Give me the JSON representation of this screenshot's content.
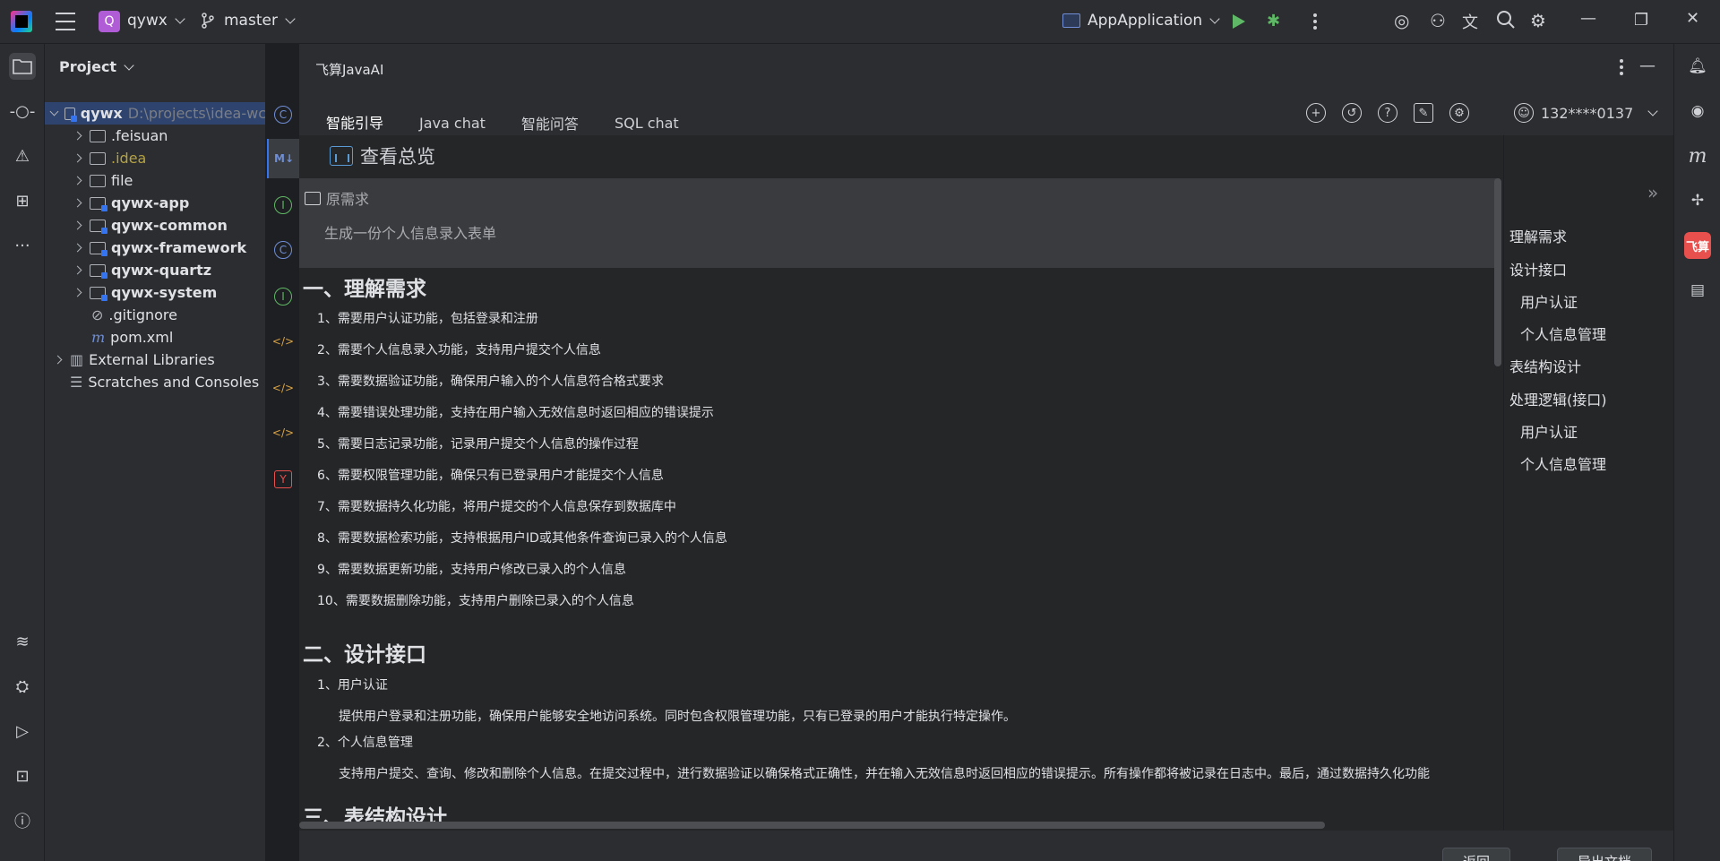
{
  "titlebar": {
    "project_badge": "Q",
    "project_name": "qywx",
    "branch": "master",
    "run_config": "AppApplication"
  },
  "project_panel": {
    "title": "Project",
    "tree": [
      {
        "label": "qywx",
        "path": "D:\\projects\\idea-wc",
        "bold": true,
        "expanded": true,
        "level": 0
      },
      {
        "label": ".feisuan",
        "level": 1
      },
      {
        "label": ".idea",
        "level": 1,
        "color": "yellow"
      },
      {
        "label": "file",
        "level": 1
      },
      {
        "label": "qywx-app",
        "level": 1,
        "bold": true
      },
      {
        "label": "qywx-common",
        "level": 1,
        "bold": true
      },
      {
        "label": "qywx-framework",
        "level": 1,
        "bold": true
      },
      {
        "label": "qywx-quartz",
        "level": 1,
        "bold": true
      },
      {
        "label": "qywx-system",
        "level": 1,
        "bold": true
      },
      {
        "label": ".gitignore",
        "level": 1
      },
      {
        "label": "pom.xml",
        "level": 1
      },
      {
        "label": "External Libraries",
        "level": 0
      },
      {
        "label": "Scratches and Consoles",
        "level": 0
      }
    ]
  },
  "editor_strip": {
    "md_tab": "M↓"
  },
  "ai_panel": {
    "title": "飞算JavaAI",
    "tabs": [
      "智能引导",
      "Java chat",
      "智能问答",
      "SQL chat"
    ],
    "user": "132****0137",
    "overview": "查看总览",
    "requirement_label": "原需求",
    "requirement_text": "生成一份个人信息录入表单",
    "section1_title": "一、理解需求",
    "section1_items": [
      "1、需要用户认证功能，包括登录和注册",
      "2、需要个人信息录入功能，支持用户提交个人信息",
      "3、需要数据验证功能，确保用户输入的个人信息符合格式要求",
      "4、需要错误处理功能，支持在用户输入无效信息时返回相应的错误提示",
      "5、需要日志记录功能，记录用户提交个人信息的操作过程",
      "6、需要权限管理功能，确保只有已登录用户才能提交个人信息",
      "7、需要数据持久化功能，将用户提交的个人信息保存到数据库中",
      "8、需要数据检索功能，支持根据用户ID或其他条件查询已录入的个人信息",
      "9、需要数据更新功能，支持用户修改已录入的个人信息",
      "10、需要数据删除功能，支持用户删除已录入的个人信息"
    ],
    "section2_title": "二、设计接口",
    "section2_subs": [
      {
        "title": "1、用户认证",
        "desc": "提供用户登录和注册功能，确保用户能够安全地访问系统。同时包含权限管理功能，只有已登录的用户才能执行特定操作。"
      },
      {
        "title": "2、个人信息管理",
        "desc": "支持用户提交、查询、修改和删除个人信息。在提交过程中，进行数据验证以确保格式正确性，并在输入无效信息时返回相应的错误提示。所有操作都将被记录在日志中。最后，通过数据持久化功能"
      }
    ],
    "section3_title": "三、表结构设计",
    "toc": [
      "理解需求",
      "设计接口",
      "用户认证",
      "个人信息管理",
      "表结构设计",
      "处理逻辑(接口)",
      "用户认证",
      "个人信息管理"
    ],
    "buttons": {
      "back": "返回",
      "export": "导出文档"
    }
  },
  "right_bar": {
    "feisuan_label": "飞算",
    "m_label": "m"
  }
}
